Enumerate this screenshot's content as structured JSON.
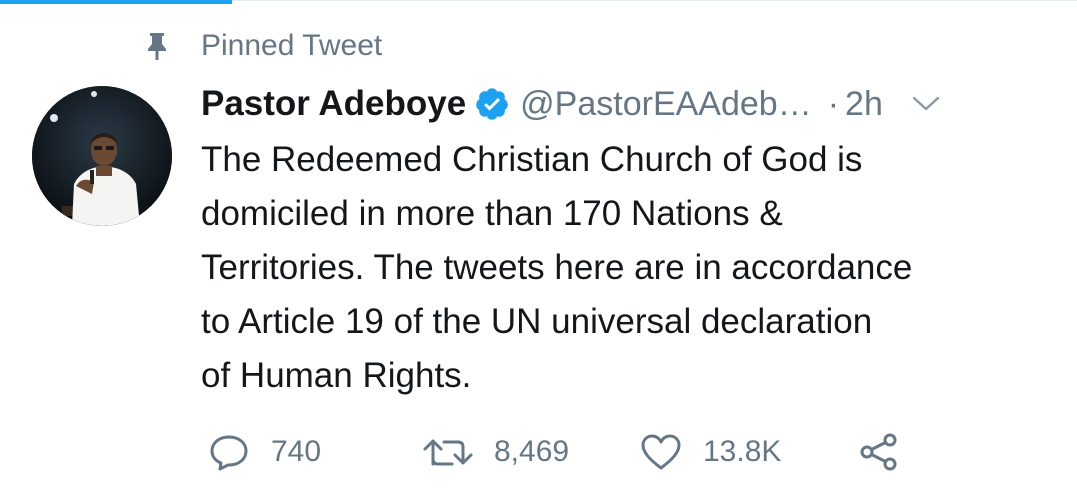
{
  "pinned": {
    "label": "Pinned Tweet",
    "icon": "pin-icon"
  },
  "tweet": {
    "author_name": "Pastor Adeboye",
    "verified": true,
    "handle": "@PastorEAAdeb…",
    "separator": "·",
    "time": "2h",
    "text_lines": [
      "The Redeemed Christian Church of God is",
      "domiciled in more than 170 Nations &",
      "Territories. The tweets here are in accordance",
      "to Article 19 of the UN universal declaration",
      "of Human Rights."
    ],
    "stats": {
      "replies": "740",
      "retweets": "8,469",
      "likes": "13.8K"
    }
  },
  "colors": {
    "accent": "#1da1f2",
    "muted": "#657786",
    "text": "#14171a"
  }
}
